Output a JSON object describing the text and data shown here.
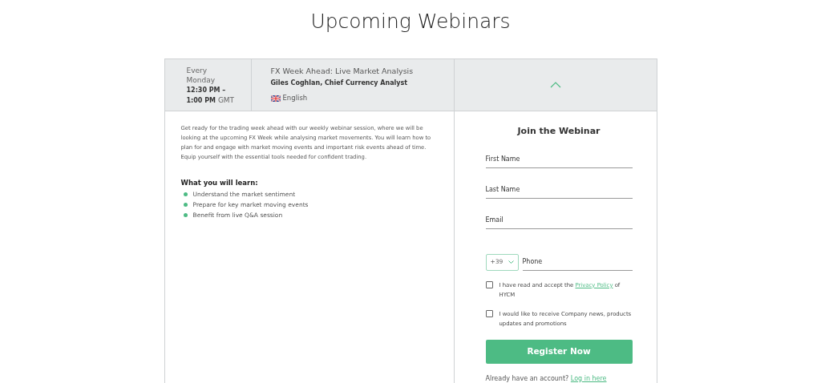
{
  "page_title": "Upcoming Webinars",
  "webinar": {
    "schedule": {
      "every": "Every",
      "day": "Monday",
      "time_start": "12:30 PM –",
      "time_end": "1:00 PM",
      "timezone": "GMT"
    },
    "title": "FX Week Ahead: Live Market Analysis",
    "presenter": "Giles Coghlan, Chief Currency Analyst",
    "language": "English",
    "expanded": true
  },
  "description": "Get ready for the trading week ahead with our weekly webinar session, where we will be looking at the upcoming FX Week while analysing market movements. You will learn how to plan for and engage with market moving events and important risk events ahead of time. Equip yourself with the essential tools needed for confident trading.",
  "learn_heading": "What you will learn:",
  "learn_items": [
    "Understand the market sentiment",
    "Prepare for key market moving events",
    "Benefit from live Q&A session"
  ],
  "form": {
    "title": "Join the Webinar",
    "fields": [
      {
        "placeholder": "First Name"
      },
      {
        "placeholder": "Last Name"
      },
      {
        "placeholder": "Email"
      }
    ],
    "phone": {
      "country_code": "+39",
      "placeholder": "Phone"
    },
    "consents": [
      {
        "text_before": "I have read and accept the ",
        "link": "Privacy Policy",
        "text_after": " of HYCM",
        "checked": false
      },
      {
        "text_before": "I would like to receive Company news, products updates and promotions",
        "checked": false
      }
    ],
    "submit": "Register Now",
    "login": {
      "prompt": "Already have an account?",
      "link": "Log in here"
    }
  }
}
